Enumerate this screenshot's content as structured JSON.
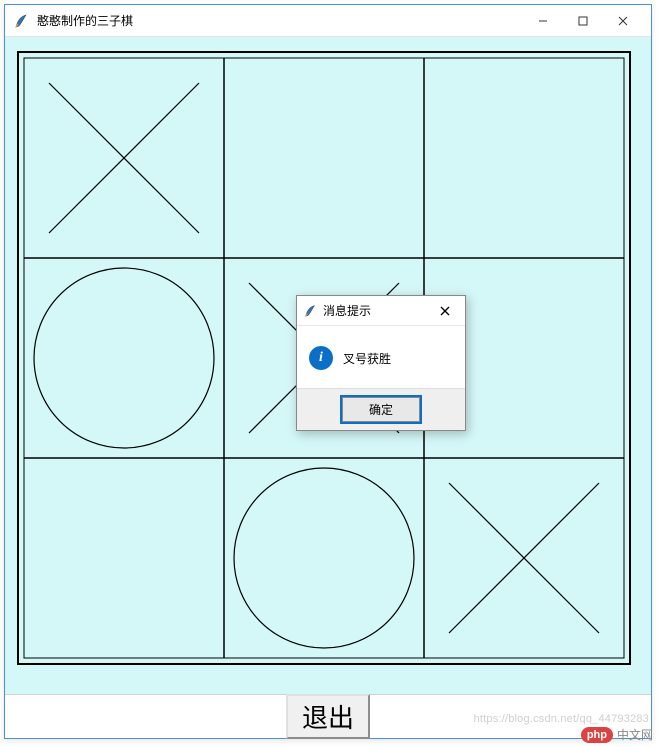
{
  "window": {
    "title": "憨憨制作的三子棋"
  },
  "board": {
    "rows": 3,
    "cols": 3,
    "cells": [
      [
        "X",
        "",
        ""
      ],
      [
        "O",
        "X",
        ""
      ],
      [
        "",
        "O",
        "X"
      ]
    ]
  },
  "footer": {
    "exit_label": "退出"
  },
  "dialog": {
    "title": "消息提示",
    "message": "叉号获胜",
    "ok_label": "确定",
    "icon": "info"
  },
  "watermark": {
    "badge": "php",
    "text": "中文网",
    "blog": "https://blog.csdn.net/qq_44793283"
  },
  "colors": {
    "canvas_bg": "#d4f7f7",
    "stroke": "#000000",
    "info_blue": "#0b6fc7",
    "badge_red": "#dd4243"
  }
}
